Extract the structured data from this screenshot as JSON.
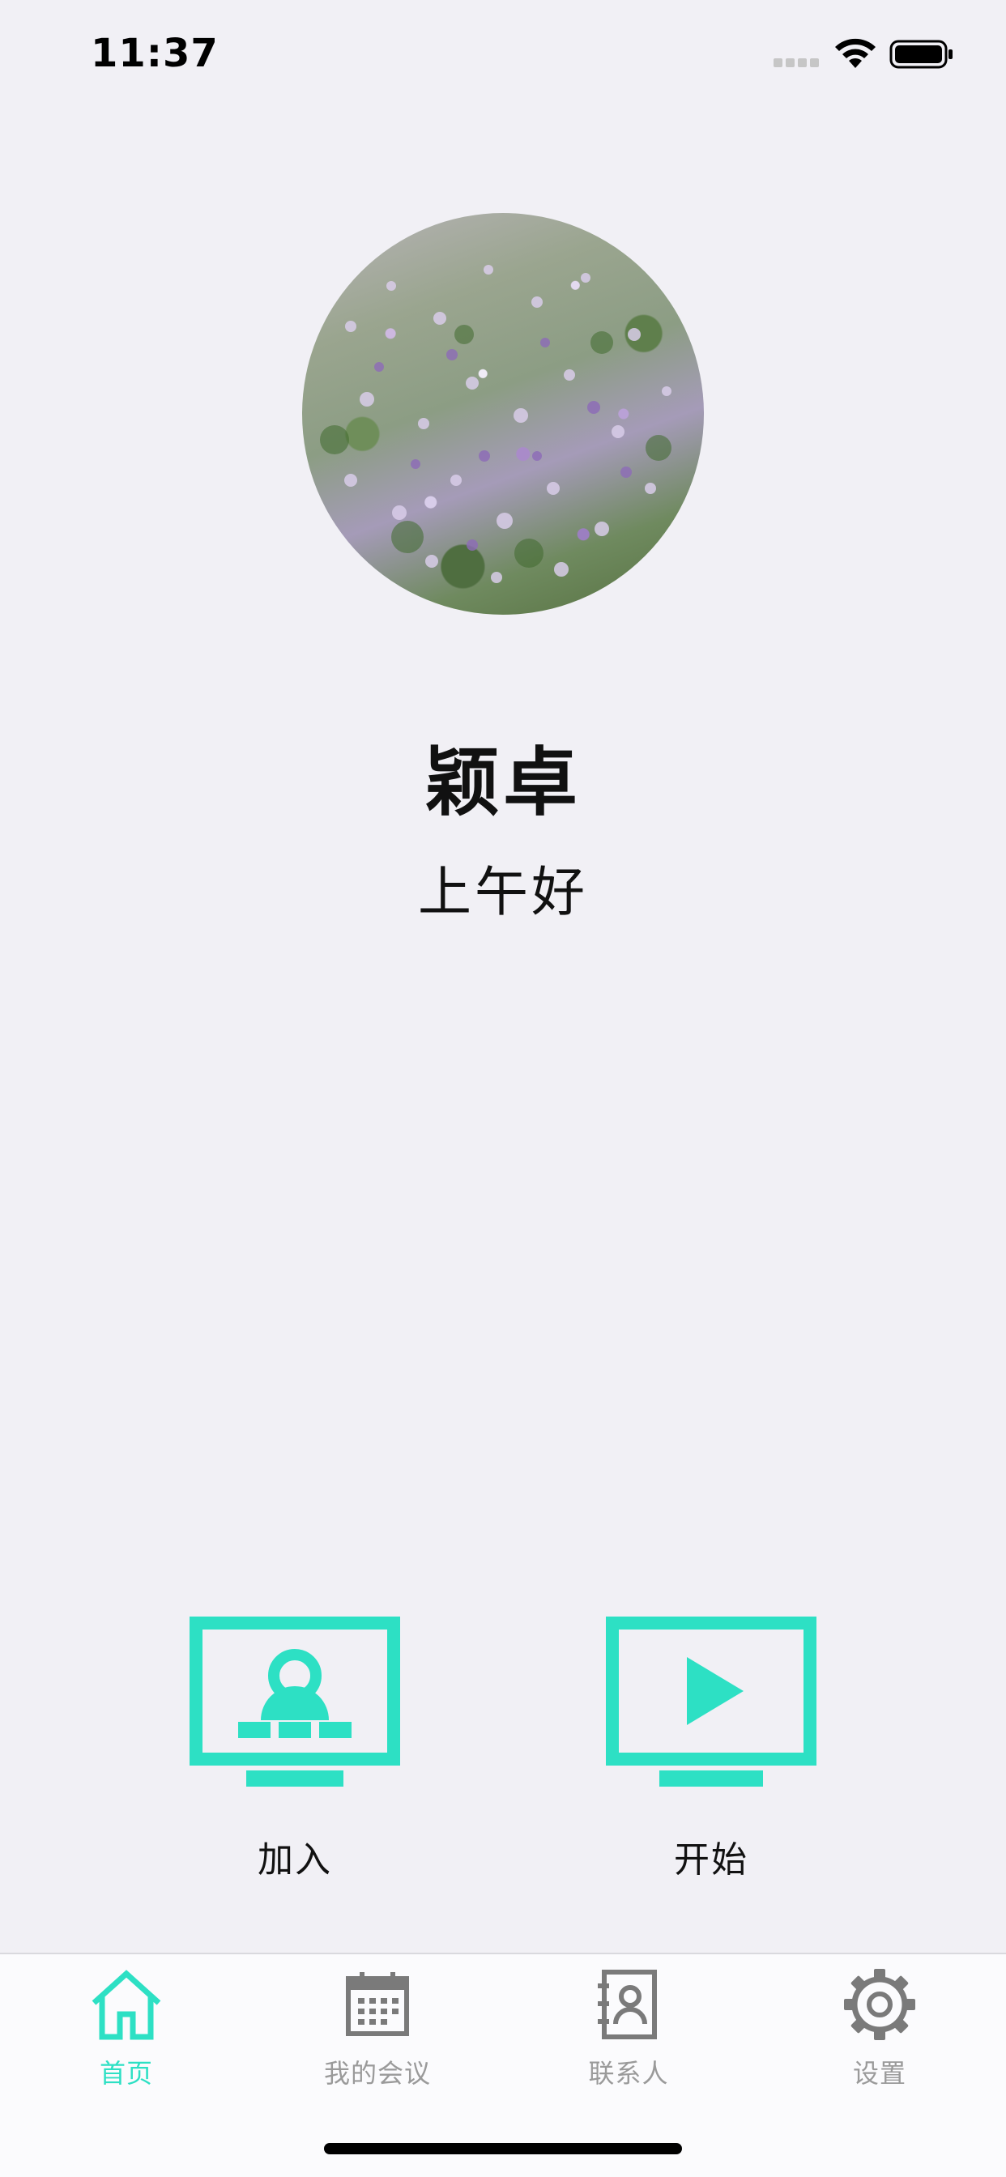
{
  "status_bar": {
    "time": "11:37"
  },
  "profile": {
    "name": "颖卓",
    "greeting": "上午好"
  },
  "actions": [
    {
      "label": "加入",
      "icon": "monitor-person-icon"
    },
    {
      "label": "开始",
      "icon": "monitor-play-icon"
    }
  ],
  "tab_bar": {
    "items": [
      {
        "label": "首页",
        "icon": "home-icon",
        "active": true
      },
      {
        "label": "我的会议",
        "icon": "calendar-icon",
        "active": false
      },
      {
        "label": "联系人",
        "icon": "contacts-icon",
        "active": false
      },
      {
        "label": "设置",
        "icon": "gear-icon",
        "active": false
      }
    ]
  },
  "colors": {
    "accent": "#2de0c4",
    "inactive": "#9a9a9a",
    "background": "#f1f0f5"
  }
}
